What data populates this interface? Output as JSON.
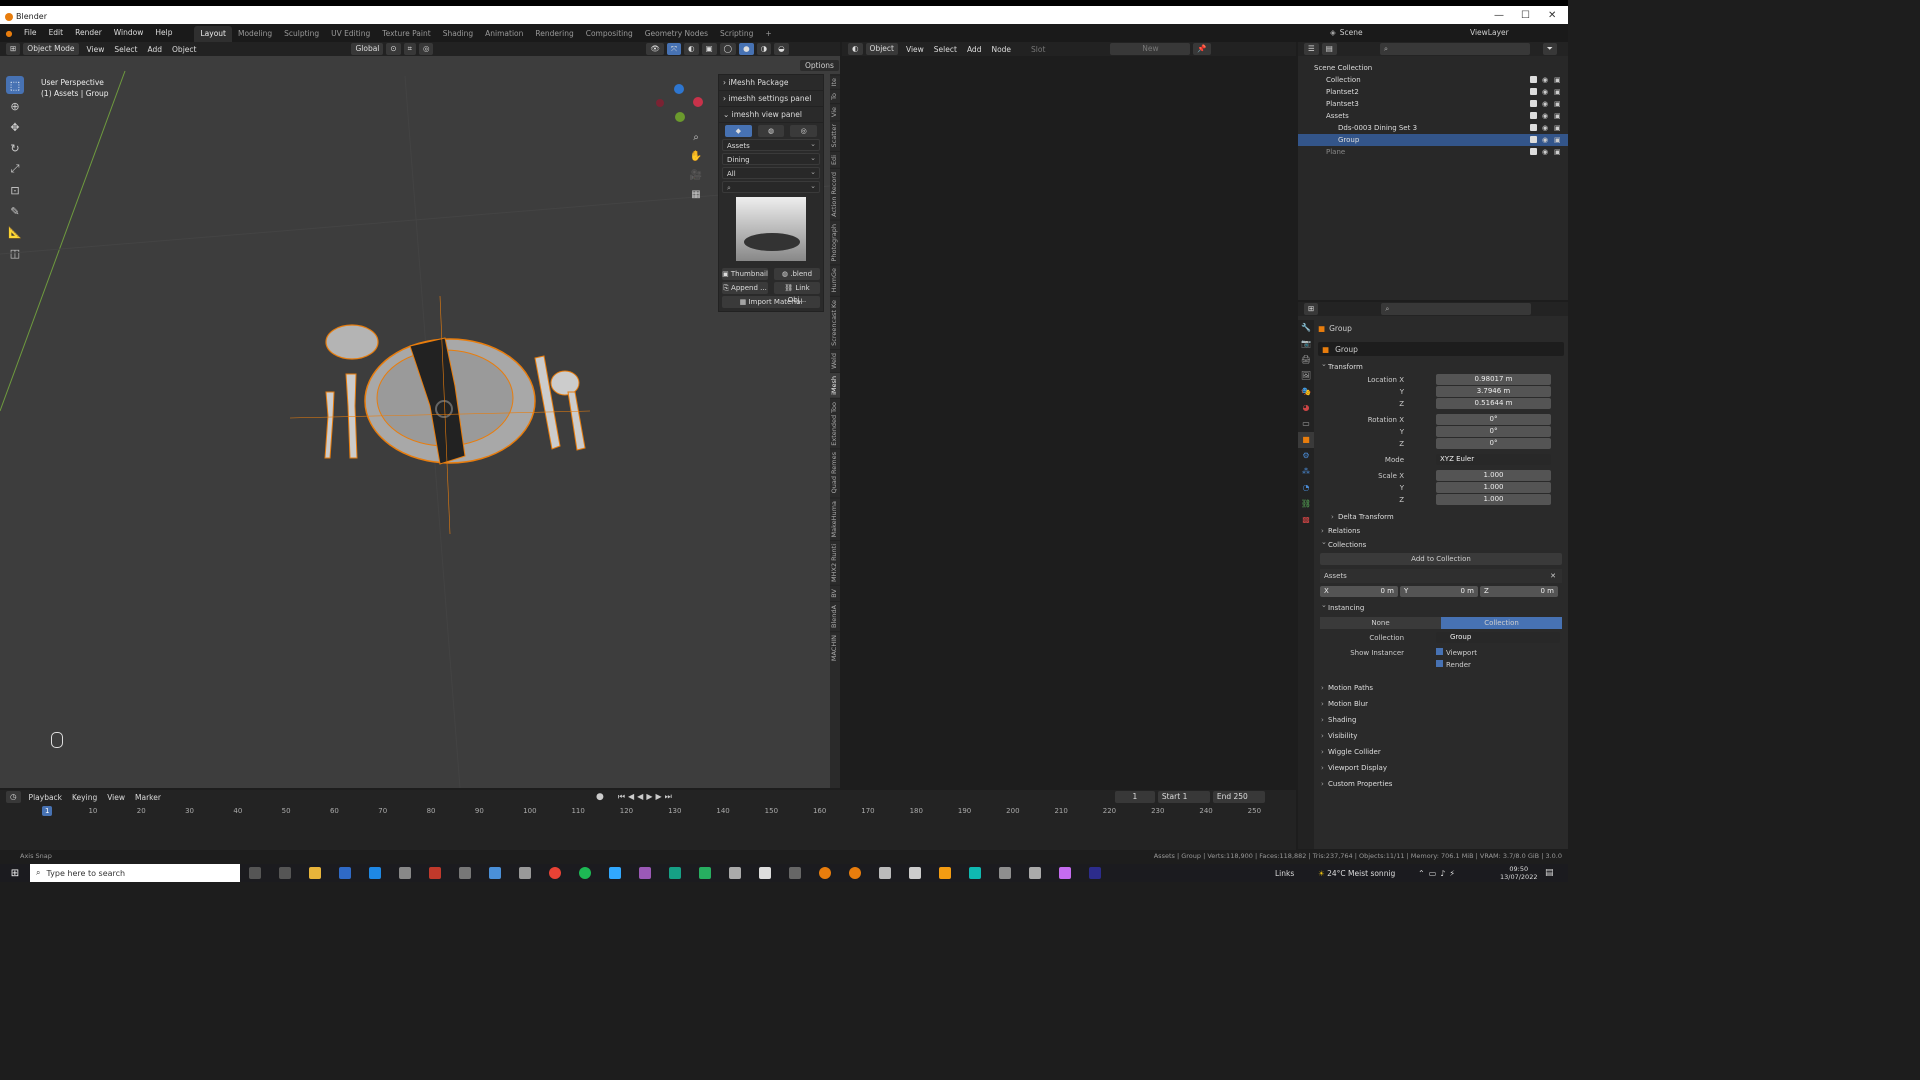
{
  "window": {
    "app_title": "Blender"
  },
  "menu": {
    "items": [
      "File",
      "Edit",
      "Render",
      "Window",
      "Help"
    ]
  },
  "workspaces": {
    "tabs": [
      "Layout",
      "Modeling",
      "Sculpting",
      "UV Editing",
      "Texture Paint",
      "Shading",
      "Animation",
      "Rendering",
      "Compositing",
      "Geometry Nodes",
      "Scripting"
    ],
    "active": "Layout"
  },
  "scene": {
    "label": "Scene",
    "view_layer": "ViewLayer"
  },
  "viewport": {
    "mode": "Object Mode",
    "menu": [
      "View",
      "Select",
      "Add",
      "Object"
    ],
    "orientation": "Global",
    "perspective": "User Perspective",
    "context": "(1) Assets | Group",
    "options": "Options"
  },
  "imeshh": {
    "headers": [
      "iMeshh Package",
      "imeshh settings panel",
      "imeshh view panel"
    ],
    "dropdowns": [
      "Assets",
      "Dining",
      "All"
    ],
    "btn_thumbnail": "Thumbnail",
    "btn_blend": ".blend",
    "btn_append": "Append ...",
    "btn_link": "Link Obj...",
    "btn_import": "Import Material"
  },
  "vtabs": [
    "Ite",
    "To",
    "Vie",
    "Scatter",
    "Edi",
    "Action Record",
    "Photograph",
    "HumGe",
    "Screencast Ke",
    "Weld",
    "iMesh",
    "Extended Too",
    "Quad Remes",
    "MakeHuma",
    "MHX2 Runti",
    "BV",
    "BlendA",
    "MACHIN"
  ],
  "node_editor": {
    "object": "Object",
    "menu": [
      "View",
      "Select",
      "Add",
      "Node"
    ],
    "slot": "Slot",
    "new": "New"
  },
  "outliner": {
    "rows": [
      {
        "label": "Scene Collection",
        "indent": 0
      },
      {
        "label": "Collection",
        "indent": 1
      },
      {
        "label": "Plantset2",
        "indent": 1
      },
      {
        "label": "Plantset3",
        "indent": 1
      },
      {
        "label": "Assets",
        "indent": 1
      },
      {
        "label": "Dds-0003 Dining Set 3",
        "indent": 2
      },
      {
        "label": "Group",
        "indent": 2,
        "selected": true
      },
      {
        "label": "Plane",
        "indent": 1,
        "dim": true
      }
    ]
  },
  "properties": {
    "object_name": "Group",
    "data_name": "Group",
    "transform": "Transform",
    "location": {
      "label": "Location X",
      "x": "0.98017 m",
      "y": "3.7946 m",
      "z": "0.51644 m"
    },
    "rotation": {
      "label": "Rotation X",
      "x": "0°",
      "y": "0°",
      "z": "0°"
    },
    "mode_label": "Mode",
    "mode": "XYZ Euler",
    "scale": {
      "label": "Scale X",
      "x": "1.000",
      "y": "1.000",
      "z": "1.000"
    },
    "axis_y": "Y",
    "axis_z": "Z",
    "delta": "Delta Transform",
    "relations": "Relations",
    "collections": "Collections",
    "add_collection": "Add to Collection",
    "collection_item": "Assets",
    "offset": {
      "x_label": "X",
      "x": "0 m",
      "y_label": "Y",
      "y": "0 m",
      "z_label": "Z",
      "z": "0 m"
    },
    "instancing": "Instancing",
    "inst_none": "None",
    "inst_collection": "Collection",
    "collection_label": "Collection",
    "collection_value": "Group",
    "show_instancer": "Show Instancer",
    "viewport": "Viewport",
    "render": "Render",
    "sections": [
      "Motion Paths",
      "Motion Blur",
      "Shading",
      "Visibility",
      "Wiggle Collider",
      "Viewport Display",
      "Custom Properties"
    ]
  },
  "timeline": {
    "menu": [
      "Playback",
      "Keying",
      "View",
      "Marker"
    ],
    "current": "1",
    "start_label": "Start",
    "start": "1",
    "end_label": "End",
    "end": "250",
    "ticks": [
      "1",
      "10",
      "20",
      "30",
      "40",
      "50",
      "60",
      "70",
      "80",
      "90",
      "100",
      "110",
      "120",
      "130",
      "140",
      "150",
      "160",
      "170",
      "180",
      "190",
      "200",
      "210",
      "220",
      "230",
      "240",
      "250"
    ]
  },
  "status": {
    "left": "Axis Snap",
    "right": "Assets | Group | Verts:118,900 | Faces:118,882 | Tris:237,764 | Objects:11/11 | Memory: 706.1 MiB | VRAM: 3.7/8.0 GiB | 3.0.0"
  },
  "taskbar": {
    "search": "Type here to search",
    "weather": "24°C  Meist sonnig",
    "links": "Links",
    "time": "09:50",
    "date": "13/07/2022"
  },
  "colors": {
    "accent": "#4772b3",
    "selection": "#e87d0d",
    "bg": "#3d3d3d"
  }
}
